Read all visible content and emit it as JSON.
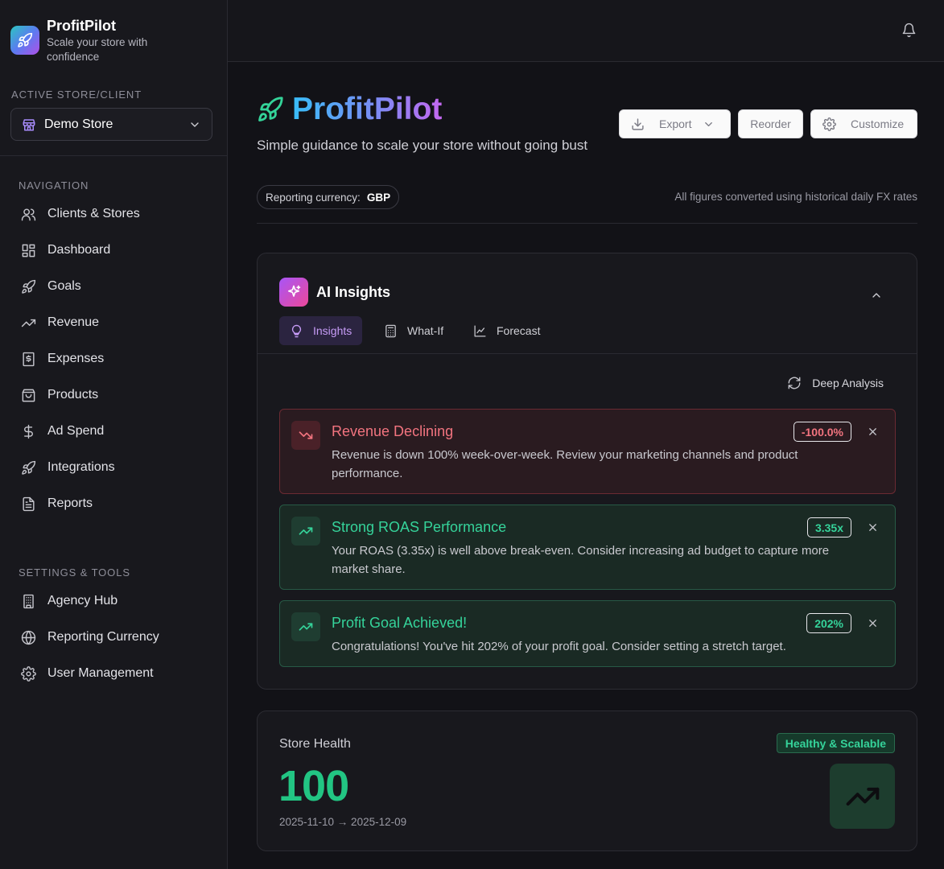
{
  "app": {
    "name": "ProfitPilot",
    "tagline": "Scale your store with confidence"
  },
  "sidebar": {
    "store_section_label": "ACTIVE STORE/CLIENT",
    "selected_store": "Demo Store",
    "nav_section_label": "NAVIGATION",
    "nav_items": [
      {
        "label": "Clients & Stores",
        "icon": "users-icon"
      },
      {
        "label": "Dashboard",
        "icon": "dashboard-icon"
      },
      {
        "label": "Goals",
        "icon": "rocket-icon"
      },
      {
        "label": "Revenue",
        "icon": "trending-up-icon"
      },
      {
        "label": "Expenses",
        "icon": "receipt-icon"
      },
      {
        "label": "Products",
        "icon": "shopping-bag-icon"
      },
      {
        "label": "Ad Spend",
        "icon": "dollar-icon"
      },
      {
        "label": "Integrations",
        "icon": "rocket-icon"
      },
      {
        "label": "Reports",
        "icon": "file-icon"
      }
    ],
    "settings_section_label": "SETTINGS & TOOLS",
    "settings_items": [
      {
        "label": "Agency Hub",
        "icon": "building-icon"
      },
      {
        "label": "Reporting Currency",
        "icon": "globe-icon"
      },
      {
        "label": "User Management",
        "icon": "gear-icon"
      }
    ]
  },
  "header": {
    "title": "ProfitPilot",
    "subtitle": "Simple guidance to scale your store without going bust",
    "export_label": "Export",
    "reorder_label": "Reorder",
    "customize_label": "Customize",
    "currency_label": "Reporting currency:",
    "currency_value": "GBP",
    "fx_note": "All figures converted using historical daily FX rates"
  },
  "ai_insights": {
    "title": "AI Insights",
    "tabs": [
      {
        "label": "Insights",
        "icon": "lightbulb-icon",
        "active": true
      },
      {
        "label": "What-If",
        "icon": "calculator-icon",
        "active": false
      },
      {
        "label": "Forecast",
        "icon": "line-chart-icon",
        "active": false
      }
    ],
    "deep_analysis_label": "Deep Analysis",
    "items": [
      {
        "type": "negative",
        "title": "Revenue Declining",
        "body": "Revenue is down 100% week-over-week. Review your marketing channels and product performance.",
        "badge": "-100.0%"
      },
      {
        "type": "positive",
        "title": "Strong ROAS Performance",
        "body": "Your ROAS (3.35x) is well above break-even. Consider increasing ad budget to capture more market share.",
        "badge": "3.35x"
      },
      {
        "type": "positive",
        "title": "Profit Goal Achieved!",
        "body": "Congratulations! You've hit 202% of your profit goal. Consider setting a stretch target.",
        "badge": "202%"
      }
    ]
  },
  "store_health": {
    "label": "Store Health",
    "status": "Healthy & Scalable",
    "score": "100",
    "date_range": "2025-11-10 → 2025-12-09"
  },
  "colors": {
    "accent_purple": "#c79cf7",
    "negative": "#f2747f",
    "positive": "#35d39a",
    "score_green": "#22c583"
  }
}
